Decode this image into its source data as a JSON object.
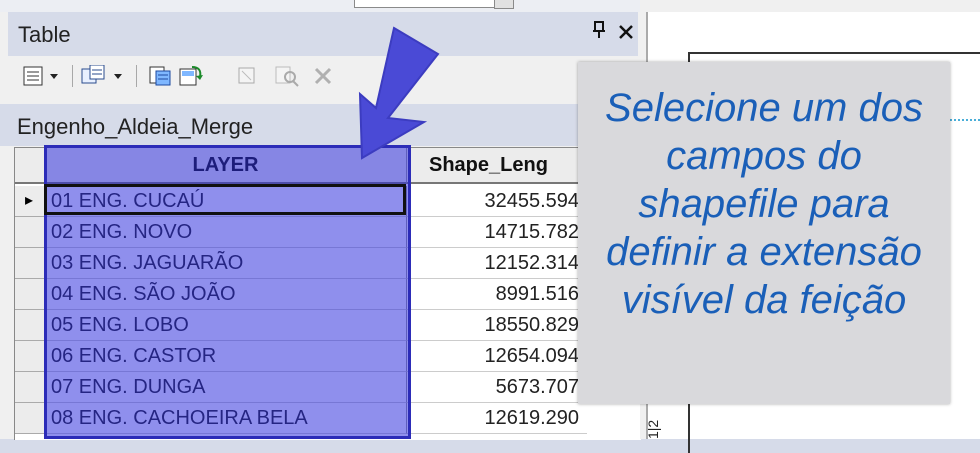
{
  "window": {
    "title": "Table"
  },
  "titlebar": {
    "pin_icon": "pin-icon",
    "close_icon": "close-icon",
    "pin_glyph": "ᴛ",
    "close_glyph": "✕"
  },
  "toolbar": {
    "items": [
      "table-options-icon",
      "related-tables-icon",
      "select-by-attributes-icon",
      "switch-selection-icon",
      "clear-selection-icon",
      "zoom-to-selected-icon",
      "delete-selected-icon"
    ]
  },
  "layer": {
    "name": "Engenho_Aldeia_Merge"
  },
  "table": {
    "columns": [
      "LAYER",
      "Shape_Leng"
    ],
    "rows": [
      {
        "layer": "01 ENG. CUCAÚ",
        "length": "32455.594"
      },
      {
        "layer": "02 ENG. NOVO",
        "length": "14715.782"
      },
      {
        "layer": "03 ENG. JAGUARÃO",
        "length": "12152.314"
      },
      {
        "layer": "04 ENG. SÃO JOÃO",
        "length": "8991.516"
      },
      {
        "layer": "05 ENG. LOBO",
        "length": "18550.829"
      },
      {
        "layer": "06 ENG. CASTOR",
        "length": "12654.094"
      },
      {
        "layer": "07 ENG. DUNGA",
        "length": "5673.707"
      },
      {
        "layer": "08 ENG. CACHOEIRA BELA",
        "length": "12619.290"
      }
    ],
    "current_row_marker": "▸",
    "selected_column": "LAYER"
  },
  "overlay": {
    "lines": [
      "Selecione um dos",
      "campos do",
      "shapefile para",
      "definir a extensão",
      "visível da feição"
    ]
  },
  "ruler": {
    "text": "1|2"
  },
  "colors": {
    "selection": "#2c2cb8",
    "overlay_text": "#1a5fb8",
    "arrow": "#4a4ad6"
  }
}
